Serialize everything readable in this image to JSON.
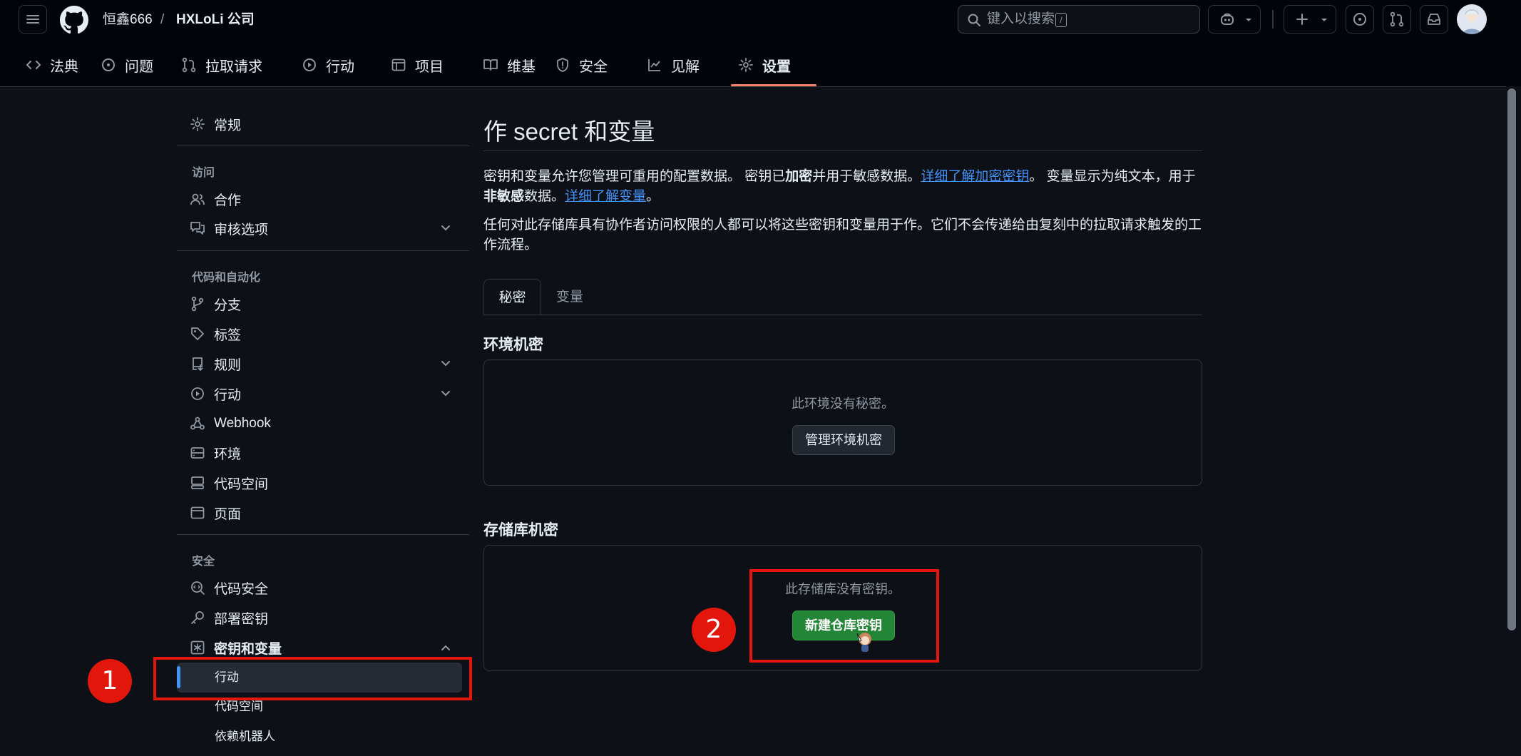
{
  "header": {
    "owner": "恒鑫666",
    "separator": "/",
    "repo": "HXLoLi 公司",
    "search_placeholder": "键入以搜索",
    "search_shortcut": "/"
  },
  "repo_tabs": [
    {
      "label": "法典",
      "icon": "code-icon"
    },
    {
      "label": "问题",
      "icon": "issue-icon"
    },
    {
      "label": "拉取请求",
      "icon": "pull-request-icon"
    },
    {
      "label": "行动",
      "icon": "play-icon"
    },
    {
      "label": "项目",
      "icon": "table-icon"
    },
    {
      "label": "维基",
      "icon": "book-icon"
    },
    {
      "label": "安全",
      "icon": "shield-icon"
    },
    {
      "label": "见解",
      "icon": "graph-icon"
    },
    {
      "label": "设置",
      "icon": "gear-icon",
      "active": true
    }
  ],
  "sidebar": {
    "general": "常规",
    "group_access": {
      "heading": "访问",
      "items": [
        "合作",
        "审核选项"
      ]
    },
    "group_code": {
      "heading": "代码和自动化",
      "items": [
        "分支",
        "标签",
        "规则",
        "行动",
        "Webhook",
        "环境",
        "代码空间",
        "页面"
      ]
    },
    "group_security": {
      "heading": "安全",
      "items": [
        "代码安全",
        "部署密钥",
        "密钥和变量"
      ]
    },
    "sub_items": [
      "行动",
      "代码空间",
      "依赖机器人"
    ]
  },
  "main": {
    "title": "作 secret 和变量",
    "para1": {
      "t1": "密钥和变量允许您管理可重用的配置数据。 密钥已",
      "b1": "加密",
      "t2": "并用于敏感数据。",
      "link1": "详细了解加密密钥",
      "t3": "。 变量显示为纯文本，用于",
      "b2": "非敏感",
      "t4": "数据。",
      "link2": "详细了解变量",
      "t5": "。"
    },
    "para2": "任何对此存储库具有协作者访问权限的人都可以将这些密钥和变量用于作。它们不会传递给由复刻中的拉取请求触发的工作流程。",
    "tabs": [
      "秘密",
      "变量"
    ],
    "env_section": {
      "heading": "环境机密",
      "empty_msg": "此环境没有秘密。",
      "button": "管理环境机密"
    },
    "repo_section": {
      "heading": "存储库机密",
      "empty_msg": "此存储库没有密钥。",
      "button": "新建仓库密钥"
    }
  },
  "annotations": {
    "badge1": "1",
    "badge2": "2"
  }
}
